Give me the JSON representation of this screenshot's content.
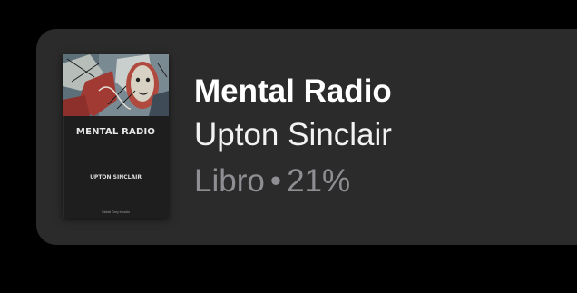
{
  "book": {
    "title": "Mental Radio",
    "author": "Upton Sinclair",
    "type": "Libro",
    "separator": "•",
    "progress": "21%",
    "cover": {
      "title": "MENTAL RADIO",
      "author": "UPTON SINCLAIR",
      "publisher": "Global Grey ebooks",
      "art_icon": "abstract-painting-face"
    }
  },
  "colors": {
    "background": "#000000",
    "card": "#2b2b2b",
    "title": "#ffffff",
    "author": "#f2f2f2",
    "meta": "#8e8e93"
  }
}
